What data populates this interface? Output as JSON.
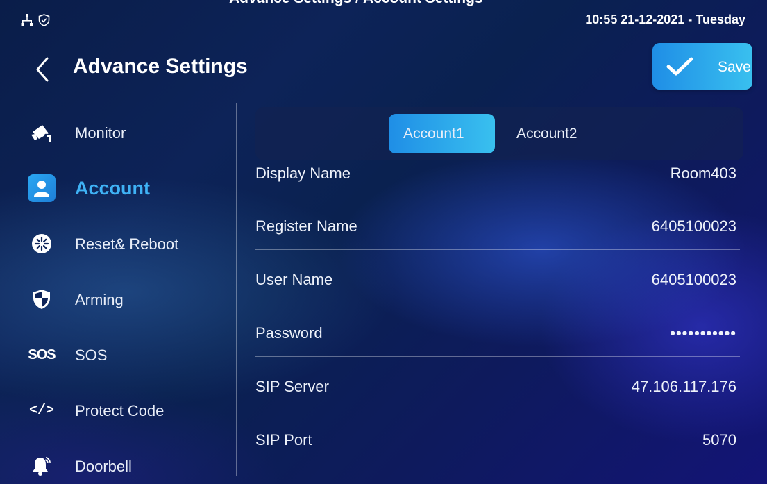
{
  "top_cut_text": "Advance Settings / Account Settings",
  "status_bar": {
    "datetime": "10:55  21-12-2021 - Tuesday"
  },
  "header": {
    "title": "Advance Settings",
    "save_label": "Save"
  },
  "sidebar": {
    "items": [
      {
        "label": "Monitor",
        "icon": "camera-icon"
      },
      {
        "label": "Account",
        "icon": "account-icon",
        "active": true
      },
      {
        "label": "Reset& Reboot",
        "icon": "reset-icon"
      },
      {
        "label": "Arming",
        "icon": "shield-icon"
      },
      {
        "label": "SOS",
        "icon": "sos-icon",
        "icon_text": "SOS"
      },
      {
        "label": "Protect Code",
        "icon": "code-icon",
        "icon_text": "</>"
      },
      {
        "label": "Doorbell",
        "icon": "bell-icon"
      }
    ]
  },
  "tabs": [
    {
      "label": "Account1",
      "active": true
    },
    {
      "label": "Account2",
      "active": false
    }
  ],
  "fields": [
    {
      "label": "Display Name",
      "value": "Room403"
    },
    {
      "label": "Register Name",
      "value": "6405100023"
    },
    {
      "label": "User Name",
      "value": "6405100023"
    },
    {
      "label": "Password",
      "value": "•••••••••••"
    },
    {
      "label": "SIP Server",
      "value": "47.106.117.176"
    },
    {
      "label": "SIP Port",
      "value": "5070"
    }
  ],
  "colors": {
    "accent": "#2aa7f2",
    "active_text": "#3fb2f5",
    "background": "#0a1d49"
  }
}
